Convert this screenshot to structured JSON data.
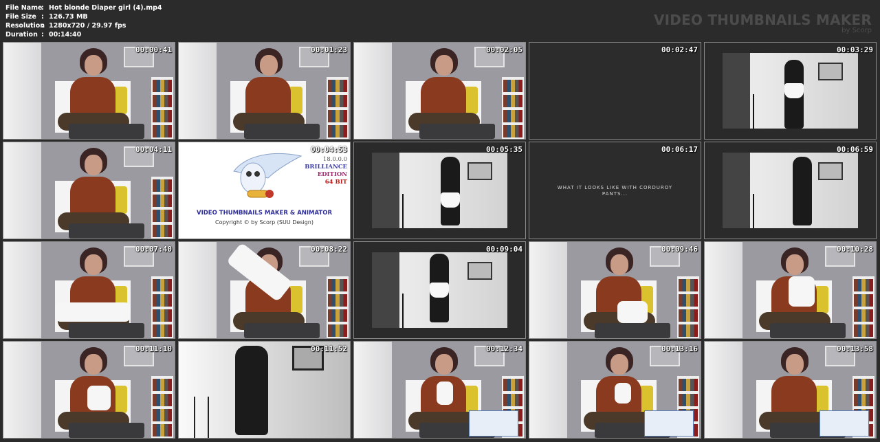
{
  "header": {
    "file_info": [
      {
        "key": "File Name",
        "sep": ":",
        "value": "Hot blonde Diaper girl (4).mp4"
      },
      {
        "key": "File Size",
        "sep": ":",
        "value": "126.73 MB"
      },
      {
        "key": "Resolution",
        "sep": ":",
        "value": "1280x720 / 29.97 fps"
      },
      {
        "key": "Duration",
        "sep": ":",
        "value": "00:14:40"
      }
    ],
    "brand_title": "VIDEO THUMBNAILS MAKER",
    "brand_sub": "by Scorp"
  },
  "thumbnails": [
    {
      "time": "00:00:41",
      "scene": "room"
    },
    {
      "time": "00:01:23",
      "scene": "room"
    },
    {
      "time": "00:02:05",
      "scene": "room"
    },
    {
      "time": "00:02:47",
      "scene": "dark"
    },
    {
      "time": "00:03:29",
      "scene": "bw"
    },
    {
      "time": "00:04:11",
      "scene": "room"
    },
    {
      "time": "00:04:53",
      "scene": "logo"
    },
    {
      "time": "00:05:35",
      "scene": "bw"
    },
    {
      "time": "00:06:17",
      "scene": "caption"
    },
    {
      "time": "00:06:59",
      "scene": "bw"
    },
    {
      "time": "00:07:40",
      "scene": "room"
    },
    {
      "time": "00:08:22",
      "scene": "room"
    },
    {
      "time": "00:09:04",
      "scene": "bw"
    },
    {
      "time": "00:09:46",
      "scene": "room"
    },
    {
      "time": "00:10:28",
      "scene": "room"
    },
    {
      "time": "00:11:10",
      "scene": "room"
    },
    {
      "time": "00:11:52",
      "scene": "corridor"
    },
    {
      "time": "00:12:34",
      "scene": "room"
    },
    {
      "time": "00:13:16",
      "scene": "room"
    },
    {
      "time": "00:13:58",
      "scene": "room"
    }
  ],
  "logo_tile": {
    "version": "18.0.0.0",
    "edition_line1": "BRILLIANCE",
    "edition_line2": "EDITION",
    "bits": "64 BIT",
    "product": "VIDEO THUMBNAILS MAKER & ANIMATOR",
    "copyright": "Copyright © by Scorp (SUU Design)"
  },
  "caption_tile": {
    "line1": "WHAT IT LOOKS LIKE WITH CORDUROY",
    "line2": "PANTS..."
  }
}
